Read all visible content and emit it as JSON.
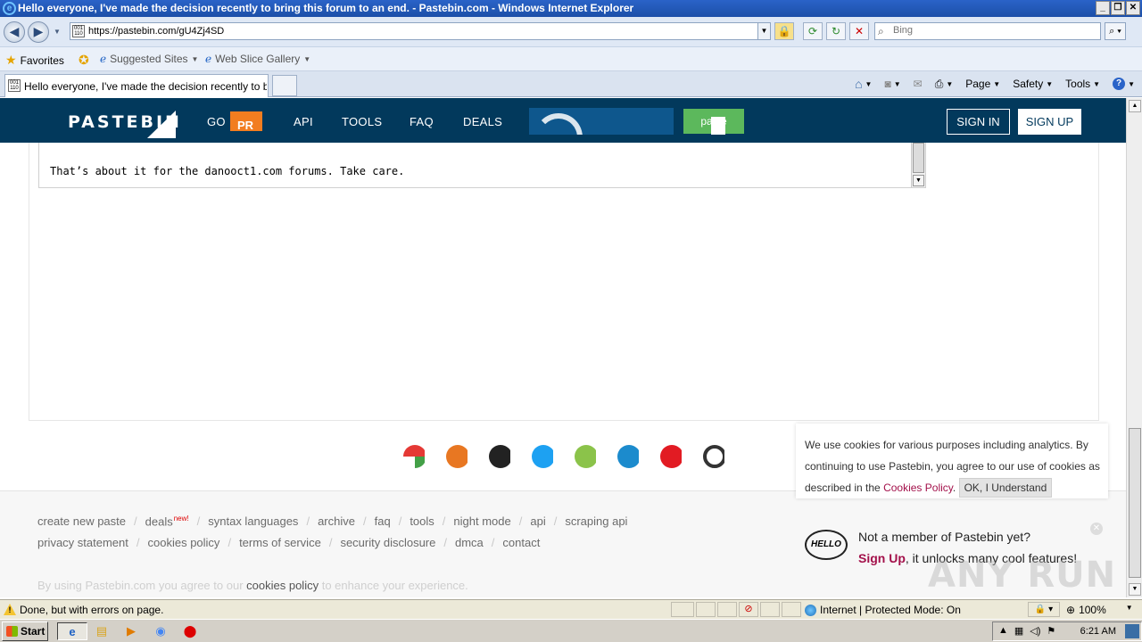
{
  "window": {
    "title": "Hello everyone, I've made the decision recently to bring this forum to an end. - Pastebin.com - Windows Internet Explorer",
    "min": "_",
    "restore": "❐",
    "close": "✕"
  },
  "address": {
    "url": "https://pastebin.com/gU4Zj4SD",
    "search_placeholder": "Bing"
  },
  "favorites_bar": {
    "favorites": "Favorites",
    "suggested_sites": "Suggested Sites",
    "web_slice_gallery": "Web Slice Gallery"
  },
  "tab": {
    "label": "Hello everyone, I've made the decision recently to bri..."
  },
  "command_bar": {
    "page": "Page",
    "safety": "Safety",
    "tools": "Tools"
  },
  "pastebin_header": {
    "logo": "PASTEBIN",
    "go": "GO",
    "go_badge": "PR",
    "nav": [
      "API",
      "TOOLS",
      "FAQ",
      "DEALS"
    ],
    "paste_button": "paste",
    "sign_in": "SIGN IN",
    "sign_up": "SIGN UP"
  },
  "paste": {
    "text": "That’s about it for the danooct1.com forums. Take care."
  },
  "footer": {
    "row1": [
      "create new paste",
      "deals",
      "syntax languages",
      "archive",
      "faq",
      "tools",
      "night mode",
      "api",
      "scraping api"
    ],
    "deals_badge": "new!",
    "row2": [
      "privacy statement",
      "cookies policy",
      "terms of service",
      "security disclosure",
      "dmca",
      "contact"
    ],
    "consent_prefix": "By using Pastebin.com you agree to our",
    "consent_link": "cookies policy",
    "consent_suffix": "to enhance your experience."
  },
  "cookie_popup": {
    "text_prefix": "We use cookies for various purposes including analytics. By continuing to use Pastebin, you agree to our use of cookies as described in the",
    "policy_link": "Cookies Policy",
    "ok_button": "OK, I Understand"
  },
  "member_popup": {
    "hello_logo": "HELLO",
    "title": "Not a member of Pastebin yet?",
    "signup_link": "Sign Up",
    "subtitle_suffix": ", it unlocks many cool features!"
  },
  "watermark": "ANY RUN",
  "status_bar": {
    "message": "Done, but with errors on page.",
    "zone": "Internet | Protected Mode: On",
    "zoom": "100%"
  },
  "taskbar": {
    "start": "Start",
    "clock": "6:21 AM"
  },
  "colors": {
    "pastebin_navy": "#02395c",
    "paste_green": "#5cb85c",
    "go_orange": "#f27d20",
    "link_magenta": "#a3104a"
  }
}
